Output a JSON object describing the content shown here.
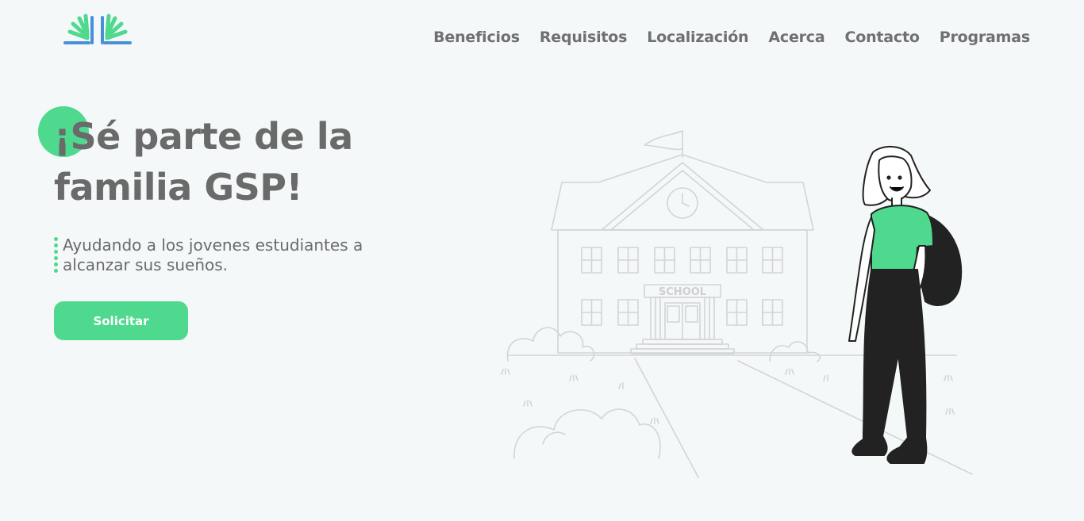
{
  "brand": {
    "logo_icon": "book-hand-logo",
    "accent": "#4fd98e",
    "logo_blue": "#4a90d9"
  },
  "nav": {
    "items": [
      {
        "label": "Beneficios"
      },
      {
        "label": "Requisitos"
      },
      {
        "label": "Localización"
      },
      {
        "label": "Acerca"
      },
      {
        "label": "Contacto"
      },
      {
        "label": "Programas"
      }
    ]
  },
  "hero": {
    "title_line1": "¡Sé parte de la",
    "title_line2": "familia GSP!",
    "subtitle_line1": "Ayudando a los jovenes estudiantes a",
    "subtitle_line2": "alcanzar sus sueños.",
    "cta_label": "Solicitar"
  },
  "illustration": {
    "school_sign": "SCHOOL",
    "icon": "school-student-illustration"
  }
}
